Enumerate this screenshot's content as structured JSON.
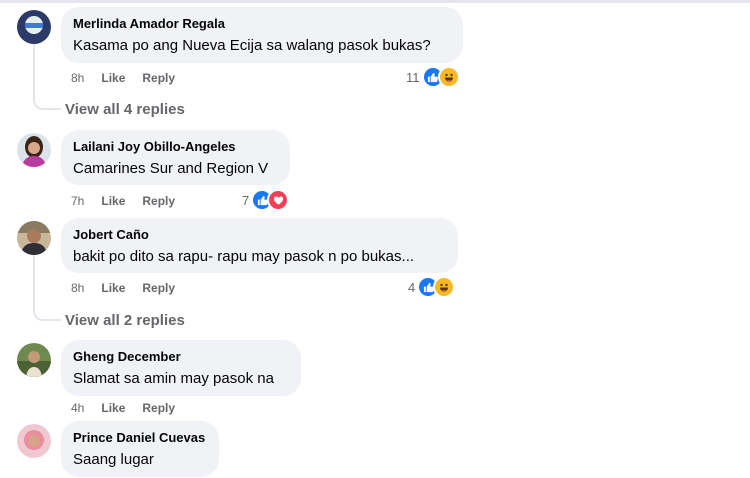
{
  "comments": [
    {
      "name": "Merlinda Amador Regala",
      "text": "Kasama po ang Nueva Ecija sa walang pasok bukas?",
      "time": "8h",
      "like": "Like",
      "reply": "Reply",
      "reaction_count": "11",
      "reactions": [
        "like-icon",
        "haha-icon"
      ],
      "view_replies": "View all 4 replies"
    },
    {
      "name": "Lailani Joy Obillo-Angeles",
      "text": "Camarines Sur and Region V",
      "time": "7h",
      "like": "Like",
      "reply": "Reply",
      "reaction_count": "7",
      "reactions": [
        "like-icon",
        "love-icon"
      ]
    },
    {
      "name": "Jobert Caño",
      "text": "bakit po dito sa rapu- rapu may pasok n po bukas...",
      "time": "8h",
      "like": "Like",
      "reply": "Reply",
      "reaction_count": "4",
      "reactions": [
        "like-icon",
        "haha-icon"
      ],
      "view_replies": "View all 2 replies"
    },
    {
      "name": "Gheng December",
      "text": "Slamat sa amin may pasok na",
      "time": "4h",
      "like": "Like",
      "reply": "Reply"
    },
    {
      "name": "Prince Daniel Cuevas",
      "text": "Saang lugar"
    }
  ],
  "colors": {
    "bubble": "#f0f2f5",
    "secondary_text": "#65676b",
    "like_blue": "#1877f2",
    "love_red": "#f33e58",
    "haha_yellow": "#f7b928"
  }
}
